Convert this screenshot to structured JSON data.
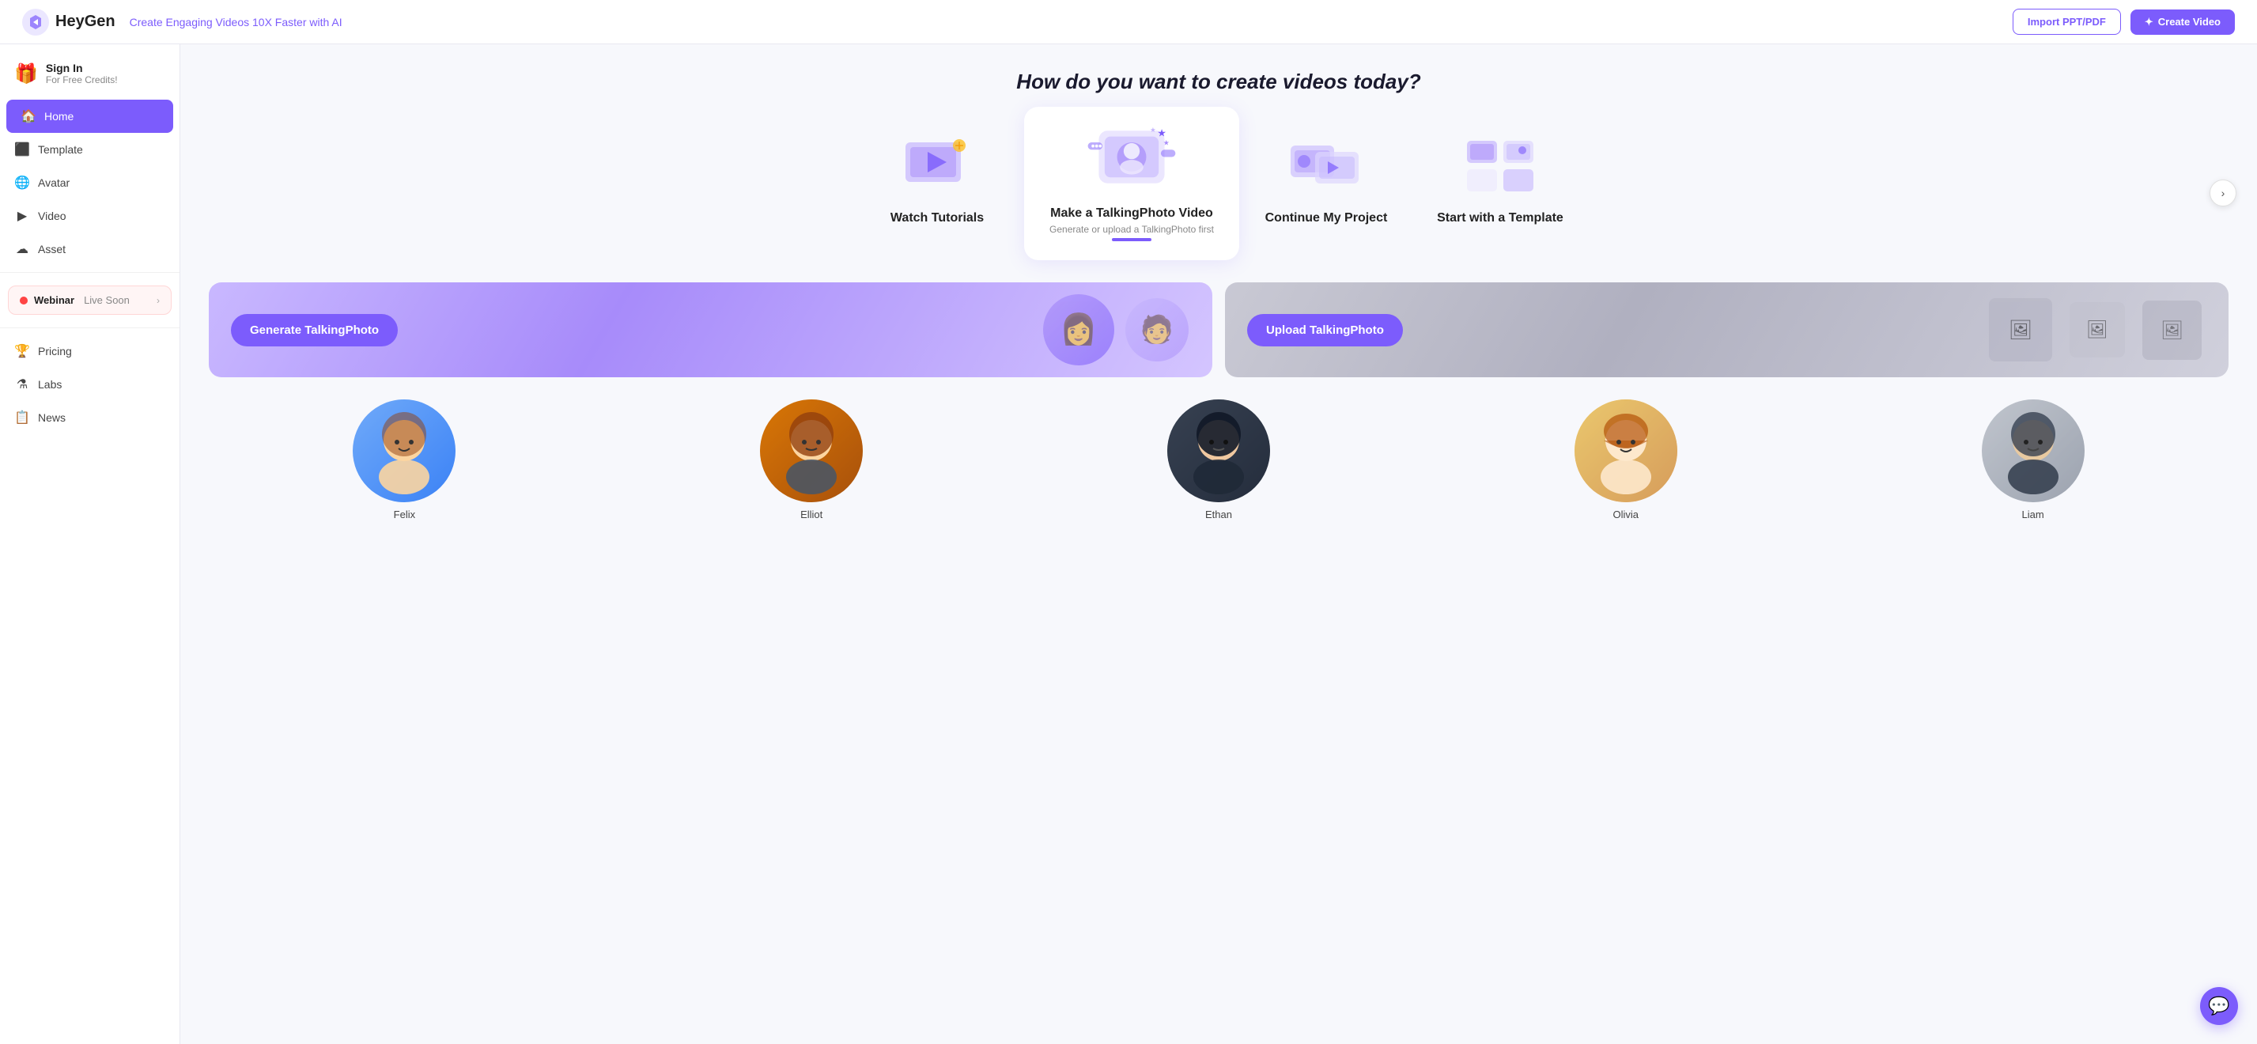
{
  "topnav": {
    "logo_text": "HeyGen",
    "tagline": "Create Engaging Videos 10X Faster with AI",
    "btn_import": "Import PPT/PDF",
    "btn_create": "Create Video"
  },
  "sidebar": {
    "signin_label": "Sign In",
    "signin_sub": "For Free Credits!",
    "items": [
      {
        "id": "home",
        "label": "Home",
        "icon": "🏠",
        "active": true
      },
      {
        "id": "template",
        "label": "Template",
        "icon": "▦"
      },
      {
        "id": "avatar",
        "label": "Avatar",
        "icon": "🌐"
      },
      {
        "id": "video",
        "label": "Video",
        "icon": "▶"
      },
      {
        "id": "asset",
        "label": "Asset",
        "icon": "☁"
      }
    ],
    "webinar_label": "Webinar",
    "webinar_soon": "Live Soon",
    "bottom_items": [
      {
        "id": "pricing",
        "label": "Pricing",
        "icon": "🏆"
      },
      {
        "id": "labs",
        "label": "Labs",
        "icon": "⚗"
      },
      {
        "id": "news",
        "label": "News",
        "icon": "📋"
      }
    ]
  },
  "main": {
    "page_title": "How do you want to create videos today?",
    "cards": [
      {
        "id": "watch-tutorials",
        "title": "Watch Tutorials",
        "subtitle": "",
        "featured": false
      },
      {
        "id": "talkingphoto",
        "title": "Make a TalkingPhoto Video",
        "subtitle": "Generate or upload a TalkingPhoto first",
        "featured": true
      },
      {
        "id": "continue",
        "title": "Continue My Project",
        "subtitle": "",
        "featured": false
      },
      {
        "id": "template",
        "title": "Start with a Template",
        "subtitle": "",
        "featured": false
      }
    ],
    "banner_generate_label": "Generate TalkingPhoto",
    "banner_upload_label": "Upload TalkingPhoto",
    "avatars": [
      {
        "name": "Felix",
        "bg": "blue-bg",
        "emoji": "👦"
      },
      {
        "name": "Elliot",
        "bg": "brown-bg",
        "emoji": "🧔"
      },
      {
        "name": "Ethan",
        "bg": "dark-bg",
        "emoji": "🧑"
      },
      {
        "name": "Olivia",
        "bg": "warm-bg",
        "emoji": "👩"
      },
      {
        "name": "Liam",
        "bg": "gray-bg",
        "emoji": "🧑"
      }
    ]
  },
  "chat": {
    "icon": "💬"
  }
}
